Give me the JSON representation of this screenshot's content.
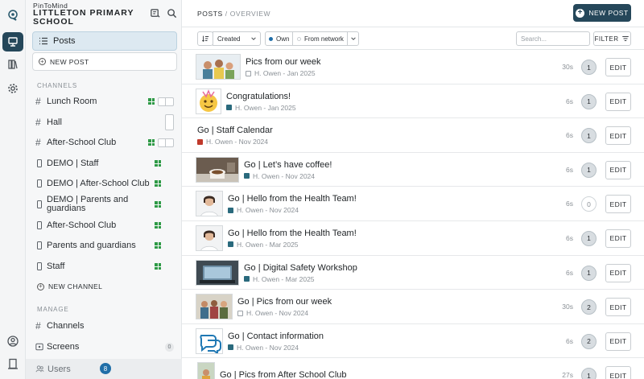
{
  "brand": {
    "app_name": "PinToMind",
    "school_name": "LITTLETON PRIMARY SCHOOL"
  },
  "sidebar": {
    "posts_label": "Posts",
    "new_post_label": "NEW POST",
    "channels_heading": "CHANNELS",
    "channels": [
      {
        "name": "Lunch Room",
        "type": "hash",
        "tiles": true,
        "toggle": "horizontal"
      },
      {
        "name": "Hall",
        "type": "hash",
        "tiles": false,
        "toggle": "vertical"
      },
      {
        "name": "After-School Club",
        "type": "hash",
        "tiles": true,
        "toggle": "horizontal"
      },
      {
        "name": "DEMO | Staff",
        "type": "device",
        "tiles": true,
        "toggle": "none"
      },
      {
        "name": "DEMO | After-School Club",
        "type": "device",
        "tiles": true,
        "toggle": "none"
      },
      {
        "name": "DEMO | Parents and guardians",
        "type": "device",
        "tiles": true,
        "toggle": "none"
      },
      {
        "name": "After-School Club",
        "type": "device",
        "tiles": true,
        "toggle": "none"
      },
      {
        "name": "Parents and guardians",
        "type": "device",
        "tiles": true,
        "toggle": "none"
      },
      {
        "name": "Staff",
        "type": "device",
        "tiles": true,
        "toggle": "none"
      }
    ],
    "new_channel_label": "NEW CHANNEL",
    "manage_heading": "MANAGE",
    "manage": [
      {
        "name": "Channels",
        "badge": ""
      },
      {
        "name": "Screens",
        "badge": "0"
      }
    ],
    "users_label": "Users",
    "users_badge": "8"
  },
  "main": {
    "breadcrumb_section": "POSTS",
    "breadcrumb_separator": "/",
    "breadcrumb_current": "OVERVIEW",
    "new_post_button": "NEW POST",
    "toolbar": {
      "sort_value": "Created",
      "filter_own": "Own",
      "filter_network": "From network",
      "search_placeholder": "Search...",
      "filter_button": "FILTER"
    }
  },
  "posts": [
    {
      "title": "Pics from our week",
      "meta": "H. Owen - Jan 2025",
      "type": "img",
      "thumb": "family",
      "time": "30s",
      "count": "1"
    },
    {
      "title": "Congratulations!",
      "meta": "H. Owen - Jan 2025",
      "type": "ann",
      "thumb": "emoji",
      "time": "6s",
      "count": "1"
    },
    {
      "title": "Go | Staff Calendar",
      "meta": "H. Owen - Nov 2024",
      "type": "cal",
      "thumb": "none",
      "time": "6s",
      "count": "1"
    },
    {
      "title": "Go | Let’s have coffee!",
      "meta": "H. Owen - Nov 2024",
      "type": "ann",
      "thumb": "coffee",
      "time": "6s",
      "count": "1"
    },
    {
      "title": "Go | Hello from the Health Team!",
      "meta": "H. Owen - Nov 2024",
      "type": "ann",
      "thumb": "person",
      "time": "6s",
      "count": "0"
    },
    {
      "title": "Go | Hello from the Health Team!",
      "meta": "H. Owen - Mar 2025",
      "type": "ann",
      "thumb": "person",
      "time": "6s",
      "count": "1"
    },
    {
      "title": "Go | Digital Safety Workshop",
      "meta": "H. Owen - Mar 2025",
      "type": "ann",
      "thumb": "laptop",
      "time": "6s",
      "count": "1"
    },
    {
      "title": "Go | Pics from our week",
      "meta": "H. Owen - Nov 2024",
      "type": "img",
      "thumb": "group",
      "time": "30s",
      "count": "2"
    },
    {
      "title": "Go | Contact information",
      "meta": "H. Owen - Nov 2024",
      "type": "ann",
      "thumb": "chat",
      "time": "6s",
      "count": "2"
    },
    {
      "title": "Go | Pics from After School Club",
      "meta": "",
      "type": "img",
      "thumb": "kids",
      "time": "27s",
      "count": "1"
    }
  ],
  "edit_label": "EDIT",
  "colors": {
    "brand_dark": "#25475a",
    "selected_bg": "#dde9f1",
    "green": "#2e9a46",
    "badge_blue": "#1f6ea8"
  }
}
